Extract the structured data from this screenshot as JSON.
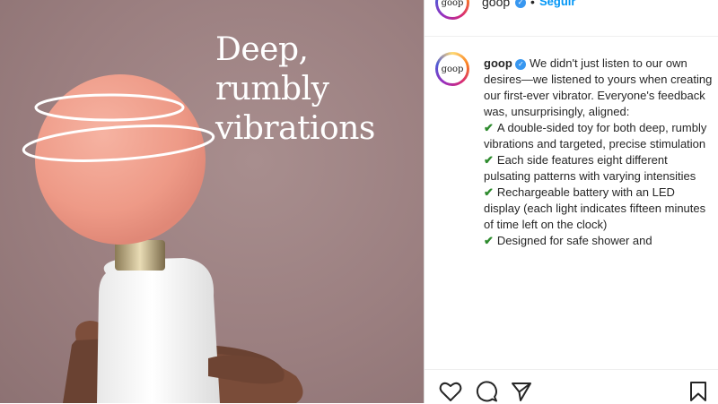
{
  "media": {
    "headline": "Deep,\nrumbly\nvibrations"
  },
  "account": {
    "avatar_text": "goop",
    "username": "goop",
    "follow_label": "Seguir"
  },
  "caption": {
    "intro": "We didn't just listen to our own desires—we listened to yours when creating our first-ever vibrator. Everyone's feedback was, unsurprisingly, aligned:",
    "bullets": [
      "A double-sided toy for both deep, rumbly vibrations and targeted, precise stimulation",
      "Each side features eight different pulsating patterns with varying intensities",
      "Rechargeable battery with an LED display (each light indicates fifteen minutes of time left on the clock)",
      "Designed for safe shower and"
    ]
  },
  "icons": {
    "like": "heart-icon",
    "comment": "comment-icon",
    "share": "share-icon",
    "save": "bookmark-icon",
    "check": "check-icon",
    "verified": "verified-badge-icon"
  },
  "colors": {
    "link": "#0095f6",
    "verified": "#3897f0",
    "check": "#2e8b2e",
    "ball": "#ef9a88",
    "background": "#9b7f80"
  }
}
